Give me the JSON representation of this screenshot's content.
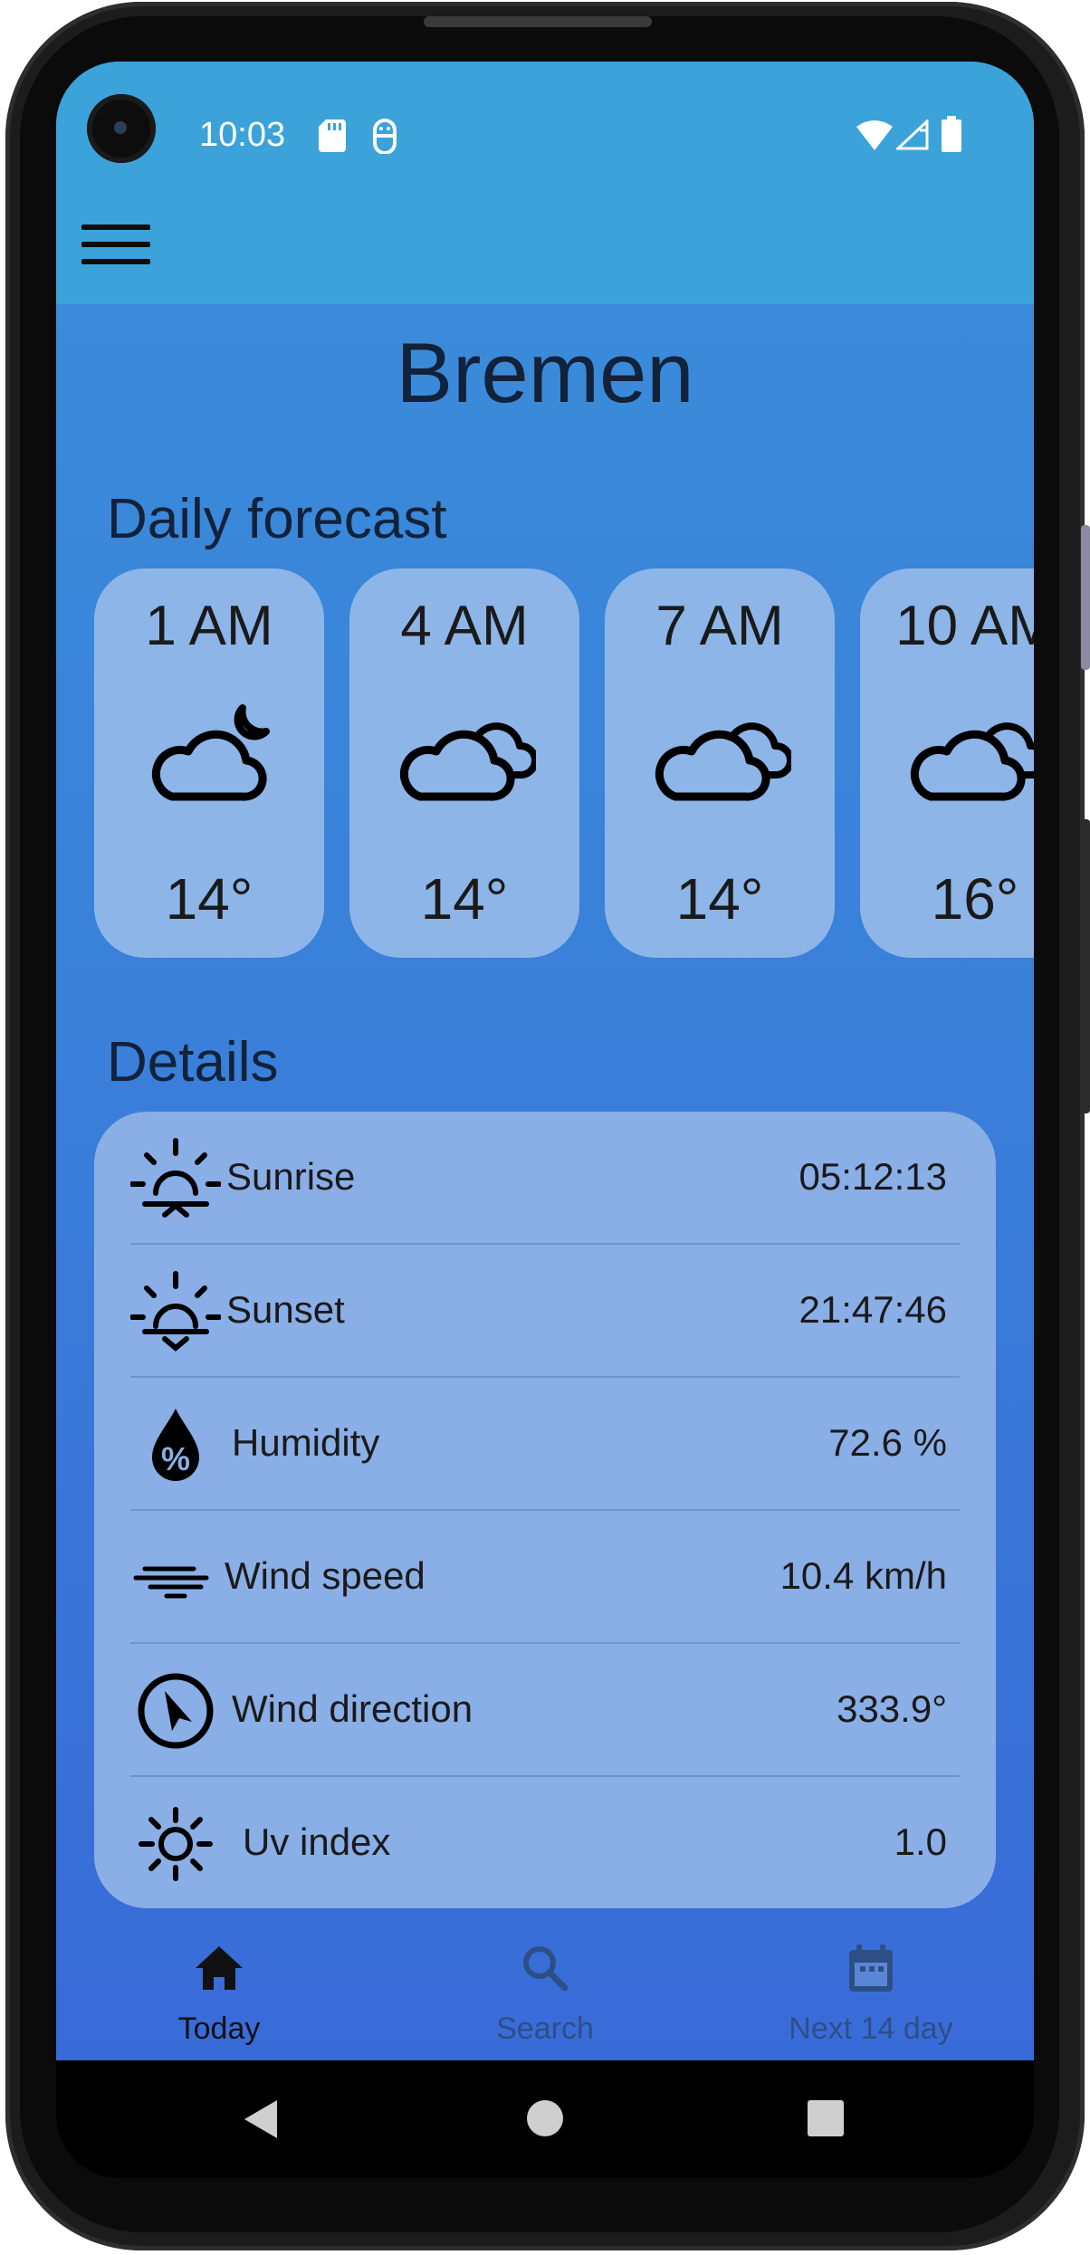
{
  "status": {
    "time": "10:03"
  },
  "city": "Bremen",
  "daily_forecast": {
    "title": "Daily forecast",
    "hours": [
      {
        "time": "1 AM",
        "icon": "cloud-moon-icon",
        "temp": "14°"
      },
      {
        "time": "4 AM",
        "icon": "clouds-icon",
        "temp": "14°"
      },
      {
        "time": "7 AM",
        "icon": "clouds-icon",
        "temp": "14°"
      },
      {
        "time": "10 AM",
        "icon": "clouds-icon",
        "temp": "16°"
      }
    ]
  },
  "details": {
    "title": "Details",
    "rows": [
      {
        "label": "Sunrise",
        "value": "05:12:13",
        "icon": "sunrise-icon"
      },
      {
        "label": "Sunset",
        "value": "21:47:46",
        "icon": "sunset-icon"
      },
      {
        "label": "Humidity",
        "value": "72.6 %",
        "icon": "humidity-icon"
      },
      {
        "label": "Wind speed",
        "value": "10.4 km/h",
        "icon": "wind-icon"
      },
      {
        "label": "Wind direction",
        "value": "333.9°",
        "icon": "compass-icon"
      },
      {
        "label": "Uv index",
        "value": "1.0",
        "icon": "sun-icon"
      }
    ]
  },
  "bottom_nav": [
    {
      "label": "Today",
      "icon": "home-icon",
      "active": true
    },
    {
      "label": "Search",
      "icon": "search-icon",
      "active": false
    },
    {
      "label": "Next 14 day",
      "icon": "calendar-icon",
      "active": false
    }
  ],
  "colors": {
    "appbar": "#3ba3d9",
    "card": "#8db5e8",
    "nav_active": "#111111",
    "nav_inactive": "#2e4f86"
  }
}
